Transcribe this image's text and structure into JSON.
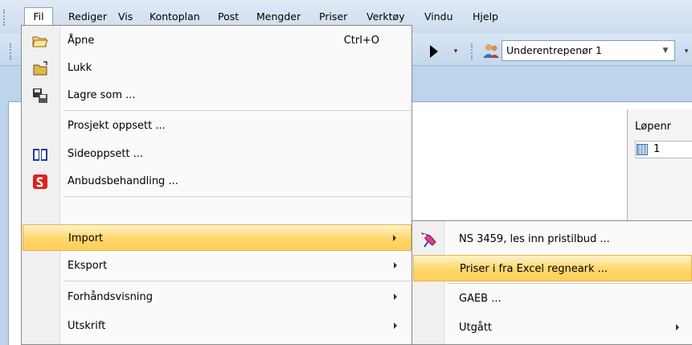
{
  "menubar": {
    "items": [
      {
        "label": "Fil"
      },
      {
        "label": "Rediger"
      },
      {
        "label": "Vis"
      },
      {
        "label": "Kontoplan"
      },
      {
        "label": "Post"
      },
      {
        "label": "Mengder"
      },
      {
        "label": "Priser"
      },
      {
        "label": "Verktøy"
      },
      {
        "label": "Vindu"
      },
      {
        "label": "Hjelp"
      }
    ]
  },
  "toolbar": {
    "combo_value": "Underentrepenør 1",
    "play_icon": "play-icon",
    "users_icon": "users-icon"
  },
  "background": {
    "lopenr_label": "Løpenr",
    "lopenr_value": "1"
  },
  "file_menu": {
    "items": [
      {
        "label": "Åpne",
        "shortcut": "Ctrl+O",
        "icon": "open-folder-icon"
      },
      {
        "label": "Lukk",
        "icon": "close-folder-icon"
      },
      {
        "label": "Lagre som ...",
        "icon": "save-as-icon"
      },
      {
        "label": "Prosjekt oppsett ..."
      },
      {
        "label": "Sideoppsett ...",
        "icon": "book-icon"
      },
      {
        "label": "Anbudsbehandling ...",
        "icon": "tender-icon"
      },
      {
        "label": "Import",
        "submenu": true,
        "highlighted": true
      },
      {
        "label": "Eksport",
        "submenu": true
      },
      {
        "label": "Forhåndsvisning",
        "submenu": true
      },
      {
        "label": "Utskrift",
        "submenu": true
      }
    ]
  },
  "import_submenu": {
    "items": [
      {
        "label": "NS 3459, les inn pristilbud ...",
        "icon": "import-price-icon"
      },
      {
        "label": "Priser i fra Excel regneark ...",
        "highlighted": true
      },
      {
        "label": "GAEB ..."
      },
      {
        "label": "Utgått",
        "submenu": true
      }
    ]
  },
  "colors": {
    "menu_highlight": "#ffd66b",
    "menubar_bg": "#dfe9f5",
    "app_bg": "#bcd4ec"
  }
}
